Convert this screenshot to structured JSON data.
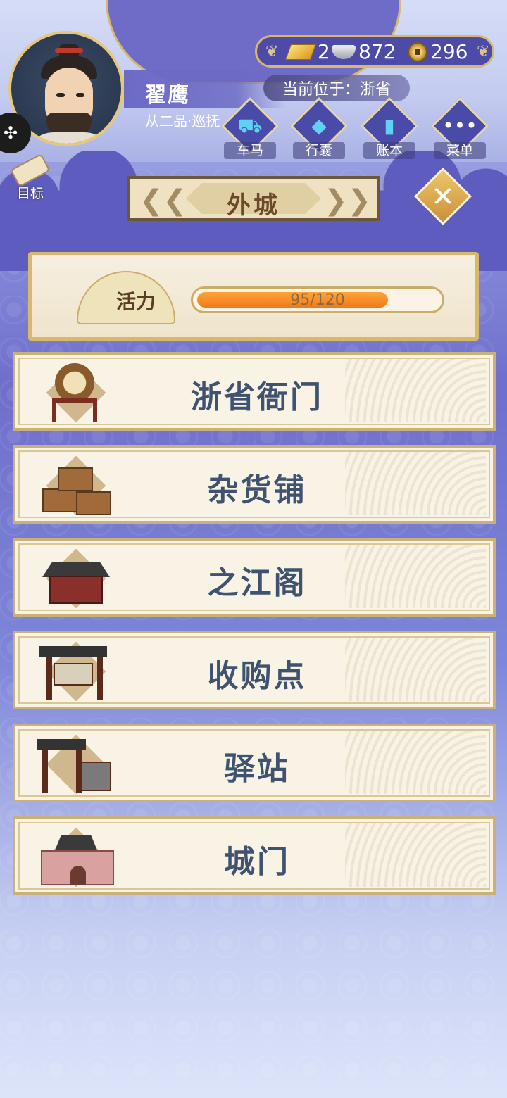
{
  "player": {
    "name": "翟鹰",
    "rank": "从二品·巡抚"
  },
  "goal": {
    "label": "目标"
  },
  "currency": {
    "gold": "2",
    "silver": "872",
    "copper": "296"
  },
  "location": {
    "current": "当前位于：浙省"
  },
  "top_menu": [
    {
      "label": "车马",
      "icon": "carriage-icon"
    },
    {
      "label": "行囊",
      "icon": "bag-icon"
    },
    {
      "label": "账本",
      "icon": "ledger-icon"
    },
    {
      "label": "菜单",
      "icon": "menu-dots-icon"
    }
  ],
  "area": {
    "title": "外城"
  },
  "stamina": {
    "label": "活力",
    "text": "95/120",
    "current": 95,
    "max": 120
  },
  "locations": [
    {
      "label": "浙省衙门",
      "icon": "drum-icon"
    },
    {
      "label": "杂货铺",
      "icon": "crates-icon"
    },
    {
      "label": "之江阁",
      "icon": "pavilion-icon"
    },
    {
      "label": "收购点",
      "icon": "purchase-gate-icon"
    },
    {
      "label": "驿站",
      "icon": "post-station-icon"
    },
    {
      "label": "城门",
      "icon": "city-gate-icon"
    }
  ],
  "colors": {
    "accent_gold": "#d8b86a",
    "panel_blue": "#5f5cc0",
    "label_text": "#3f5270",
    "stamina_fill": "#f07a1a"
  }
}
